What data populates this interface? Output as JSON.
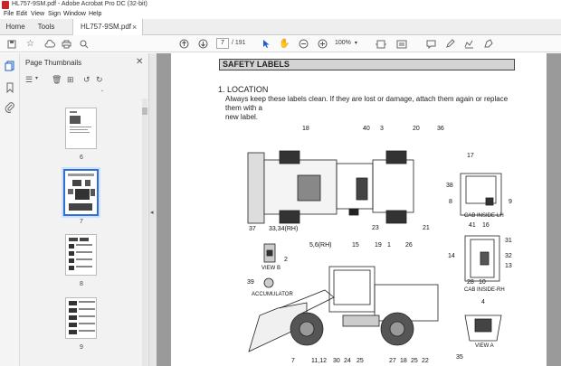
{
  "window": {
    "title": "HL757-9SM.pdf - Adobe Acrobat Pro DC (32-bit)"
  },
  "menu": [
    "File",
    "Edit",
    "View",
    "Sign",
    "Window",
    "Help"
  ],
  "tabs": {
    "home": "Home",
    "tools": "Tools",
    "document": "HL757-9SM.pdf"
  },
  "toolbar": {
    "page_current": "7",
    "page_total": "/ 191",
    "zoom": "100%"
  },
  "panel": {
    "title": "Page Thumbnails",
    "thumbnails": [
      {
        "number": "6",
        "selected": false
      },
      {
        "number": "7",
        "selected": true
      },
      {
        "number": "8",
        "selected": false
      },
      {
        "number": "9",
        "selected": false
      }
    ]
  },
  "document": {
    "section_title": "SAFETY LABELS",
    "location_heading": "1. LOCATION",
    "paragraph_line1": "Always keep these labels clean.  If they are lost or damage, attach them again or replace them with a",
    "paragraph_line2": "new label.",
    "callouts": {
      "top_view": [
        "18",
        "40",
        "3",
        "20",
        "36",
        "23",
        "21"
      ],
      "cab_inside_lh": [
        "17",
        "38",
        "8",
        "9"
      ],
      "cab_inside_lh_caption": "CAB INSIDE-LH",
      "cab_inside_rh": [
        "41",
        "16",
        "31",
        "14",
        "32",
        "13",
        "28",
        "10"
      ],
      "cab_inside_rh_caption": "CAB INSIDE-RH",
      "view_b": [
        "37",
        "33,34(RH)",
        "2"
      ],
      "view_b_caption": "VIEW B",
      "accumulator": [
        "39"
      ],
      "accumulator_caption": "ACCUMULATOR",
      "side_view_top": [
        "5,6(RH)",
        "15",
        "19",
        "1",
        "26"
      ],
      "side_view_bottom": [
        "7",
        "11,12",
        "30",
        "24",
        "25",
        "27",
        "18",
        "25",
        "22"
      ],
      "view_a": [
        "4",
        "35"
      ],
      "view_a_caption": "VIEW A"
    }
  },
  "colors": {
    "acrobat_red": "#c62828",
    "selection_blue": "#2f6fd6",
    "canvas_gray": "#9a9a9a"
  }
}
